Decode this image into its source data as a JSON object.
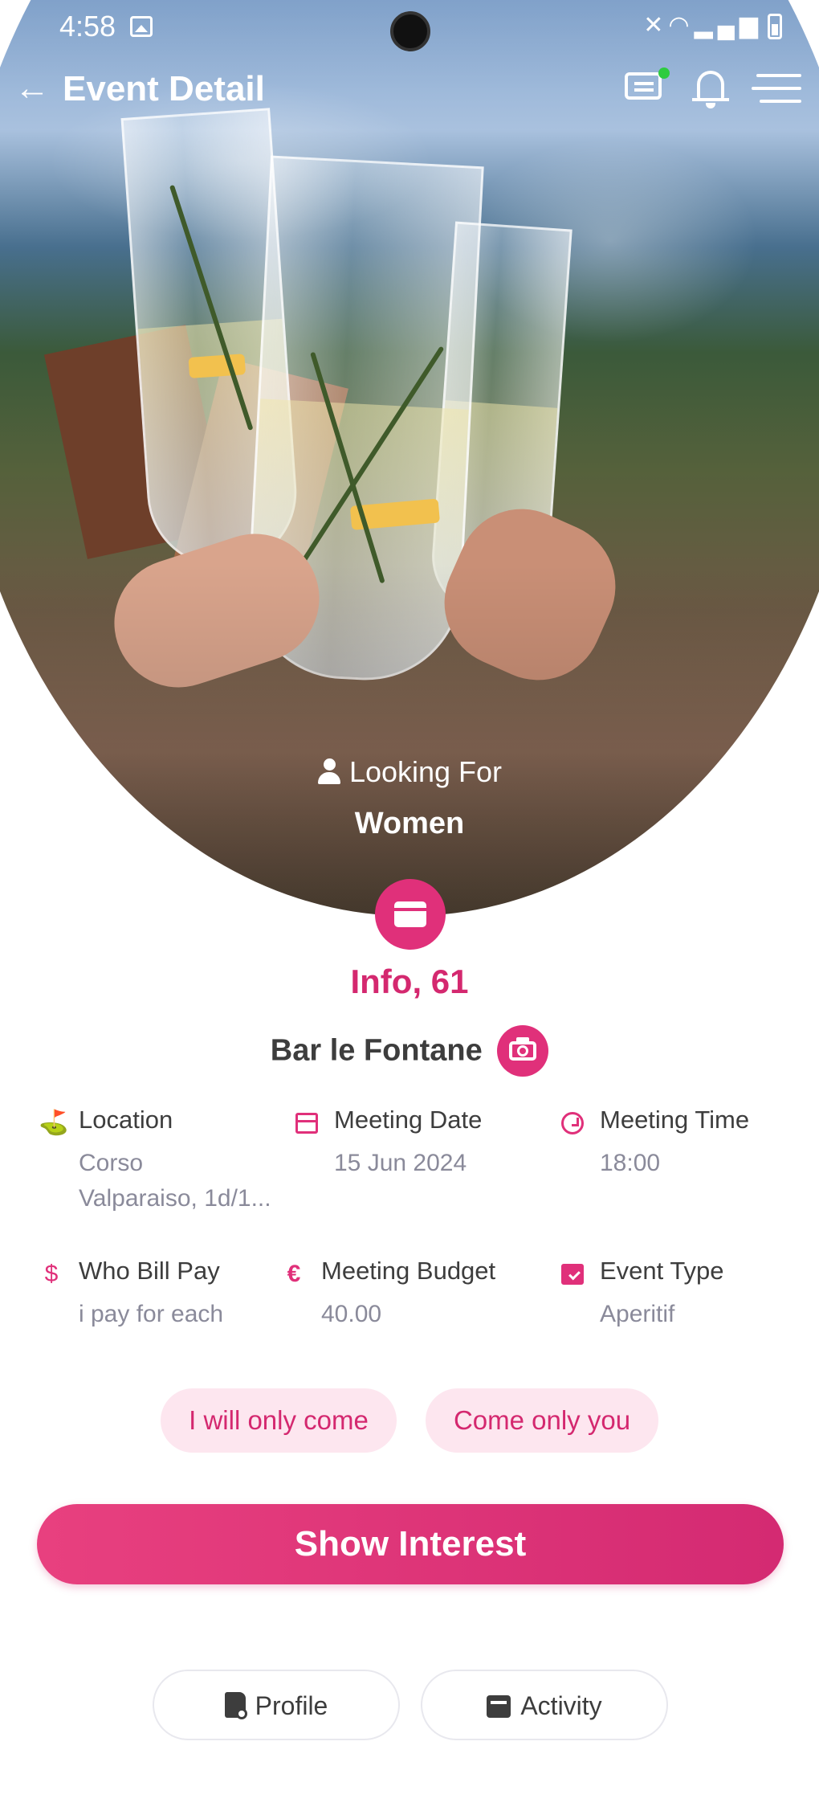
{
  "status_bar": {
    "time": "4:58",
    "icons": [
      "gallery-icon",
      "mute-icon",
      "wifi-icon",
      "signal-icon",
      "battery-icon"
    ]
  },
  "header": {
    "title": "Event Detail",
    "back_icon": "arrow-left-icon",
    "chat_icon": "chat-icon",
    "bell_icon": "bell-icon",
    "menu_icon": "hamburger-menu-icon",
    "chat_badge_color": "#2ecc40"
  },
  "hero": {
    "looking_for_label": "Looking For",
    "looking_for_value": "Women"
  },
  "event": {
    "name": "Info, 61",
    "venue": "Bar le Fontane"
  },
  "details": [
    {
      "icon": "map-pin-icon",
      "label": "Location",
      "value": "Corso\nValparaiso, 1d/1..."
    },
    {
      "icon": "calendar-icon",
      "label": "Meeting Date",
      "value": "15 Jun 2024"
    },
    {
      "icon": "clock-icon",
      "label": "Meeting Time",
      "value": "18:00"
    },
    {
      "icon": "money-hand-icon",
      "label": "Who Bill Pay",
      "value": "i pay for each"
    },
    {
      "icon": "euro-icon",
      "label": "Meeting Budget",
      "value": "40.00"
    },
    {
      "icon": "event-type-icon",
      "label": "Event Type",
      "value": "Aperitif"
    }
  ],
  "chips": [
    "I will only come",
    "Come only you"
  ],
  "primary_action": "Show Interest",
  "tabs": [
    {
      "label": "Profile",
      "icon": "profile-doc-icon"
    },
    {
      "label": "Activity",
      "icon": "activity-icon"
    }
  ],
  "colors": {
    "accent": "#e0307a",
    "accent_text": "#d4286f",
    "chip_bg": "#fde6ef",
    "muted_text": "#8a8a9a"
  }
}
